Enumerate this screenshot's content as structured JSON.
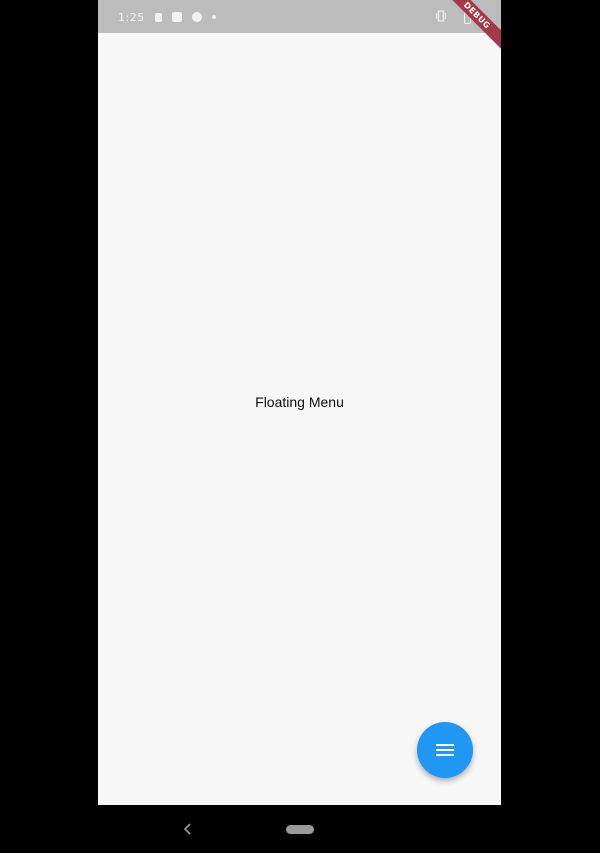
{
  "status_bar": {
    "time": "1:25",
    "icons": [
      "sim-icon",
      "notification-icon",
      "shield-icon",
      "dot-icon",
      "vibrate-icon",
      "battery-icon"
    ]
  },
  "debug_banner": {
    "label": "DEBUG"
  },
  "main": {
    "center_text": "Floating Menu"
  },
  "fab": {
    "icon": "menu-icon",
    "color": "#2196f3"
  },
  "nav_bar": {
    "back_icon": "back-icon",
    "home_icon": "home-pill-icon"
  },
  "colors": {
    "status_bar_bg": "#bcbcbc",
    "screen_bg": "#f7f7f8",
    "ribbon": "#a23a4a"
  }
}
